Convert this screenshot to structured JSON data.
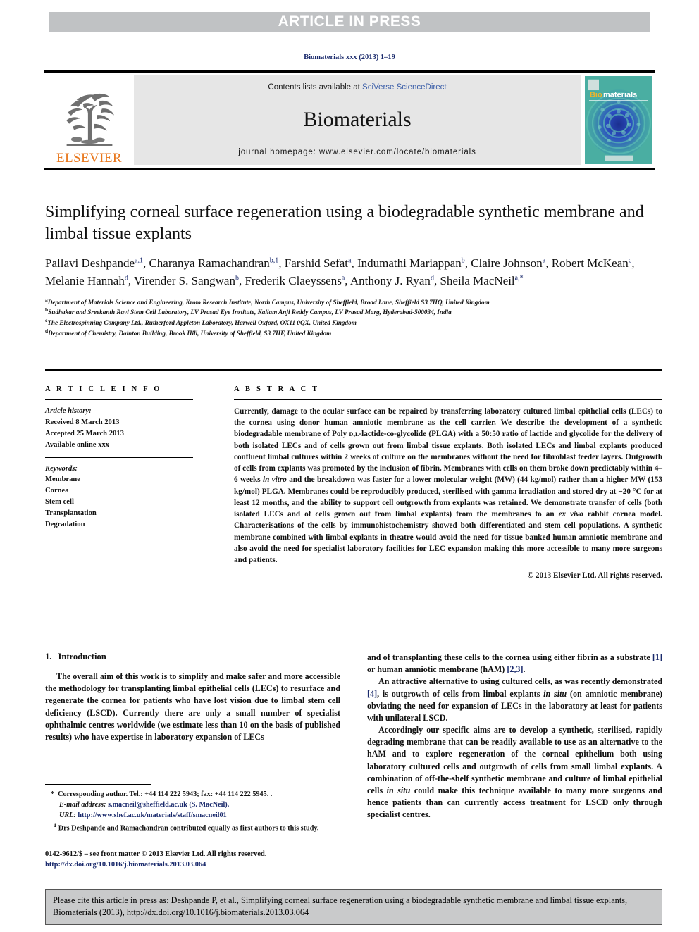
{
  "banner": {
    "label": "ARTICLE IN PRESS"
  },
  "journal_ref": "Biomaterials xxx (2013) 1–19",
  "masthead": {
    "publisher_name": "ELSEVIER",
    "contents_prefix": "Contents lists available at ",
    "contents_link": "SciVerse ScienceDirect",
    "journal_title": "Biomaterials",
    "homepage": "journal homepage: www.elsevier.com/locate/biomaterials",
    "cover_title_bio": "Bio",
    "cover_title_materials": "materials"
  },
  "article": {
    "title": "Simplifying corneal surface regeneration using a biodegradable synthetic membrane and limbal tissue explants",
    "authors": [
      {
        "name": "Pallavi Deshpande",
        "sup": "a,1",
        "sep": ", "
      },
      {
        "name": "Charanya Ramachandran",
        "sup": "b,1",
        "sep": ", "
      },
      {
        "name": "Farshid Sefat",
        "sup": "a",
        "sep": ", "
      },
      {
        "name": "Indumathi Mariappan",
        "sup": "b",
        "sep": ", "
      },
      {
        "name": "Claire Johnson",
        "sup": "a",
        "sep": ", "
      },
      {
        "name": "Robert McKean",
        "sup": "c",
        "sep": ", "
      },
      {
        "name": "Melanie Hannah",
        "sup": "d",
        "sep": ", "
      },
      {
        "name": "Virender S. Sangwan",
        "sup": "b",
        "sep": ", "
      },
      {
        "name": "Frederik Claeyssens",
        "sup": "a",
        "sep": ", "
      },
      {
        "name": "Anthony J. Ryan",
        "sup": "d",
        "sep": ", "
      },
      {
        "name": "Sheila MacNeil",
        "sup": "a,*",
        "sep": ""
      }
    ],
    "affiliations": [
      {
        "mark": "a",
        "text": "Department of Materials Science and Engineering, Kroto Research Institute, North Campus, University of Sheffield, Broad Lane, Sheffield S3 7HQ, United Kingdom"
      },
      {
        "mark": "b",
        "text": "Sudhakar and Sreekanth Ravi Stem Cell Laboratory, LV Prasad Eye Institute, Kallam Anji Reddy Campus, LV Prasad Marg, Hyderabad-500034, India"
      },
      {
        "mark": "c",
        "text": "The Electrospinning Company Ltd., Rutherford Appleton Laboratory, Harwell Oxford, OX11 0QX, United Kingdom"
      },
      {
        "mark": "d",
        "text": "Department of Chemistry, Dainton Building, Brook Hill, University of Sheffield, S3 7HF, United Kingdom"
      }
    ]
  },
  "article_info": {
    "heading": "A R T I C L E   I N F O",
    "history_label": "Article history:",
    "history": [
      "Received 8 March 2013",
      "Accepted 25 March 2013",
      "Available online xxx"
    ],
    "keywords_label": "Keywords:",
    "keywords": [
      "Membrane",
      "Cornea",
      "Stem cell",
      "Transplantation",
      "Degradation"
    ]
  },
  "abstract": {
    "heading": "A B S T R A C T",
    "text": "Currently, damage to the ocular surface can be repaired by transferring laboratory cultured limbal epithelial cells (LECs) to the cornea using donor human amniotic membrane as the cell carrier. We describe the development of a synthetic biodegradable membrane of Poly D,L-lactide-co-glycolide (PLGA) with a 50:50 ratio of lactide and glycolide for the delivery of both isolated LECs and of cells grown out from limbal tissue explants. Both isolated LECs and limbal explants produced confluent limbal cultures within 2 weeks of culture on the membranes without the need for fibroblast feeder layers. Outgrowth of cells from explants was promoted by the inclusion of fibrin. Membranes with cells on them broke down predictably within 4–6 weeks in vitro and the breakdown was faster for a lower molecular weight (MW) (44 kg/mol) rather than a higher MW (153 kg/mol) PLGA. Membranes could be reproducibly produced, sterilised with gamma irradiation and stored dry at −20 °C for at least 12 months, and the ability to support cell outgrowth from explants was retained. We demonstrate transfer of cells (both isolated LECs and of cells grown out from limbal explants) from the membranes to an ex vivo rabbit cornea model. Characterisations of the cells by immunohistochemistry showed both differentiated and stem cell populations. A synthetic membrane combined with limbal explants in theatre would avoid the need for tissue banked human amniotic membrane and also avoid the need for specialist laboratory facilities for LEC expansion making this more accessible to many more surgeons and patients.",
    "copyright": "© 2013 Elsevier Ltd. All rights reserved."
  },
  "introduction": {
    "number": "1.",
    "heading": "Introduction",
    "left_paragraph": "The overall aim of this work is to simplify and make safer and more accessible the methodology for transplanting limbal epithelial cells (LECs) to resurface and regenerate the cornea for patients who have lost vision due to limbal stem cell deficiency (LSCD). Currently there are only a small number of specialist ophthalmic centres worldwide (we estimate less than 10 on the basis of published results) who have expertise in laboratory expansion of LECs",
    "right_continuation": "and of transplanting these cells to the cornea using either fibrin as a substrate [1] or human amniotic membrane (hAM) [2,3].",
    "right_paragraph_2": "An attractive alternative to using cultured cells, as was recently demonstrated [4], is outgrowth of cells from limbal explants in situ (on amniotic membrane) obviating the need for expansion of LECs in the laboratory at least for patients with unilateral LSCD.",
    "right_paragraph_3": "Accordingly our specific aims are to develop a synthetic, sterilised, rapidly degrading membrane that can be readily available to use as an alternative to the hAM and to explore regeneration of the corneal epithelium both using laboratory cultured cells and outgrowth of cells from small limbal explants. A combination of off-the-shelf synthetic membrane and culture of limbal epithelial cells in situ could make this technique available to many more surgeons and hence patients than can currently access treatment for LSCD only through specialist centres."
  },
  "footnotes": {
    "corresponding": "Corresponding author. Tel.: +44 114 222 5943; fax: +44 114 222 5945. .",
    "corresponding_mark": "*",
    "email_label": "E-mail address:",
    "email_value": "s.macneil@sheffield.ac.uk (S. MacNeil).",
    "url_label": "URL:",
    "url_value": "http://www.shef.ac.uk/materials/staff/smacneil01",
    "equal_contrib_mark": "1",
    "equal_contrib": "Drs Deshpande and Ramachandran contributed equally as first authors to this study."
  },
  "issn": {
    "line1": "0142-9612/$ – see front matter © 2013 Elsevier Ltd. All rights reserved.",
    "doi": "http://dx.doi.org/10.1016/j.biomaterials.2013.03.064"
  },
  "cite_box": {
    "text": "Please cite this article in press as: Deshpande P, et al., Simplifying corneal surface regeneration using a biodegradable synthetic membrane and limbal tissue explants, Biomaterials (2013), http://dx.doi.org/10.1016/j.biomaterials.2013.03.064"
  },
  "colors": {
    "banner_grey": "#c0c2c4",
    "band_grey": "#e6e6e6",
    "elsevier_orange": "#e8761b",
    "link_blue": "#3b5ea8",
    "ref_navy": "#1a2a6c",
    "cite_box_grey": "#c9cacb"
  }
}
